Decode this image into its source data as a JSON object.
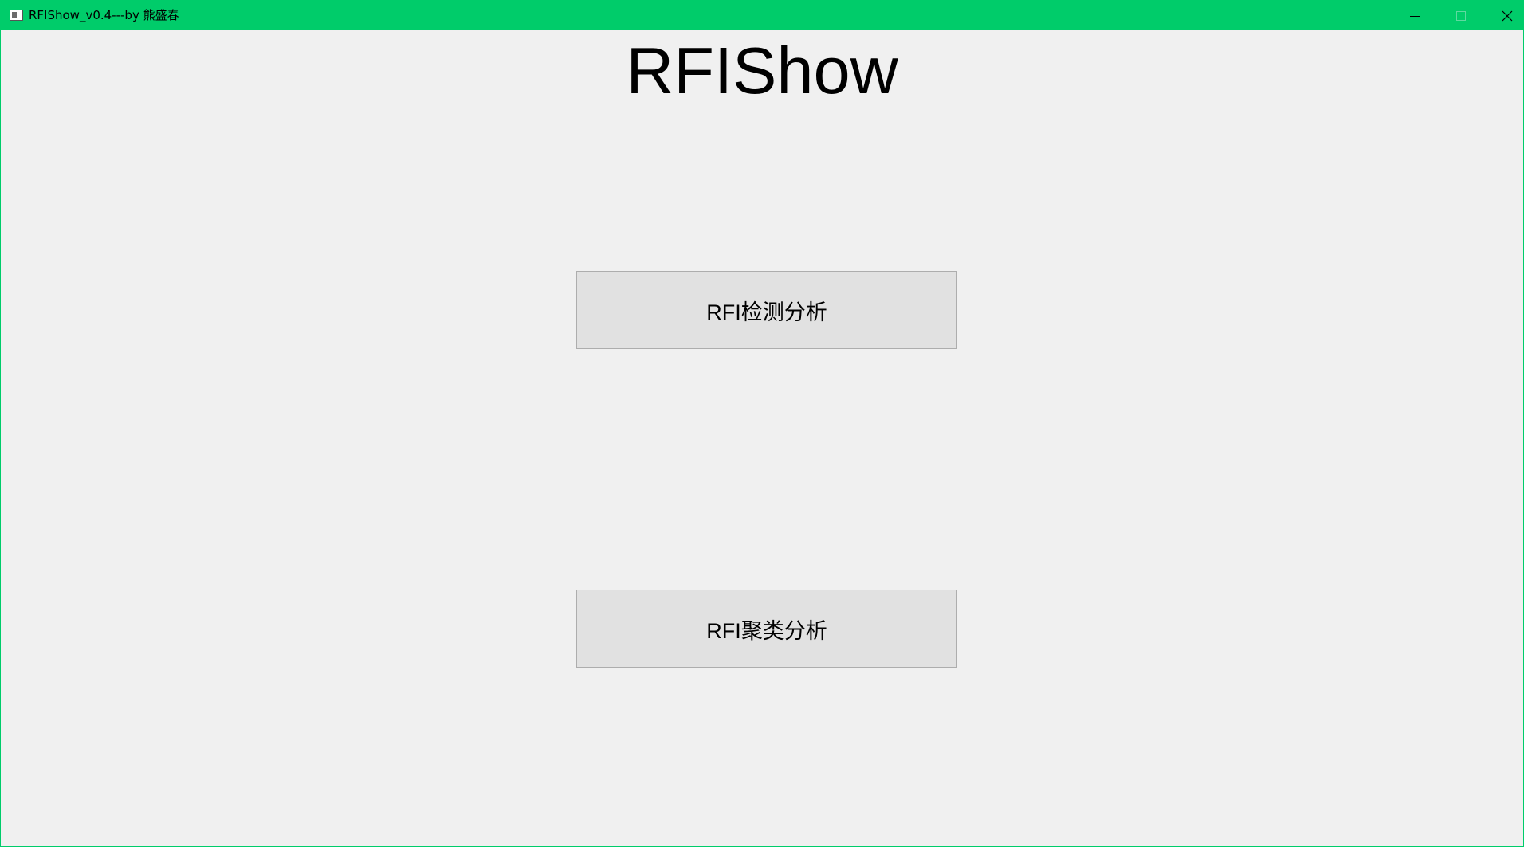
{
  "window": {
    "title": "RFIShow_v0.4---by 熊盛春",
    "accent_color": "#00cc6a",
    "controls": {
      "minimize_icon": "minimize-icon",
      "maximize_icon": "maximize-icon",
      "close_icon": "close-icon"
    }
  },
  "main": {
    "heading": "RFIShow",
    "buttons": [
      {
        "label": "RFI检测分析"
      },
      {
        "label": "RFI聚类分析"
      }
    ]
  }
}
